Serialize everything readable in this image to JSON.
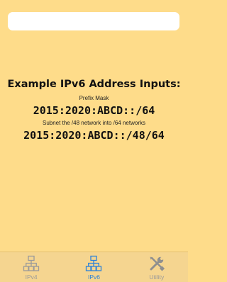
{
  "search": {
    "value": "",
    "placeholder": ""
  },
  "main": {
    "heading": "Example IPv6 Address Inputs:",
    "prefix_caption": "Prefix Mask",
    "prefix_example": "2015:2020:ABCD::/64",
    "subnet_caption": "Subnet the /48 network into /64 networks",
    "subnet_example": "2015:2020:ABCD::/48/64"
  },
  "tabbar": {
    "tabs": [
      {
        "label": "IPv4",
        "icon": "network-icon",
        "active": false
      },
      {
        "label": "IPv6",
        "icon": "network-icon",
        "active": true
      },
      {
        "label": "Utility",
        "icon": "tools-icon",
        "active": false
      }
    ]
  },
  "colors": {
    "background": "#fedc8a",
    "tabbar_background": "#f5d590",
    "active_tab": "#2b82d9",
    "inactive_tab": "#9a9a9a"
  }
}
